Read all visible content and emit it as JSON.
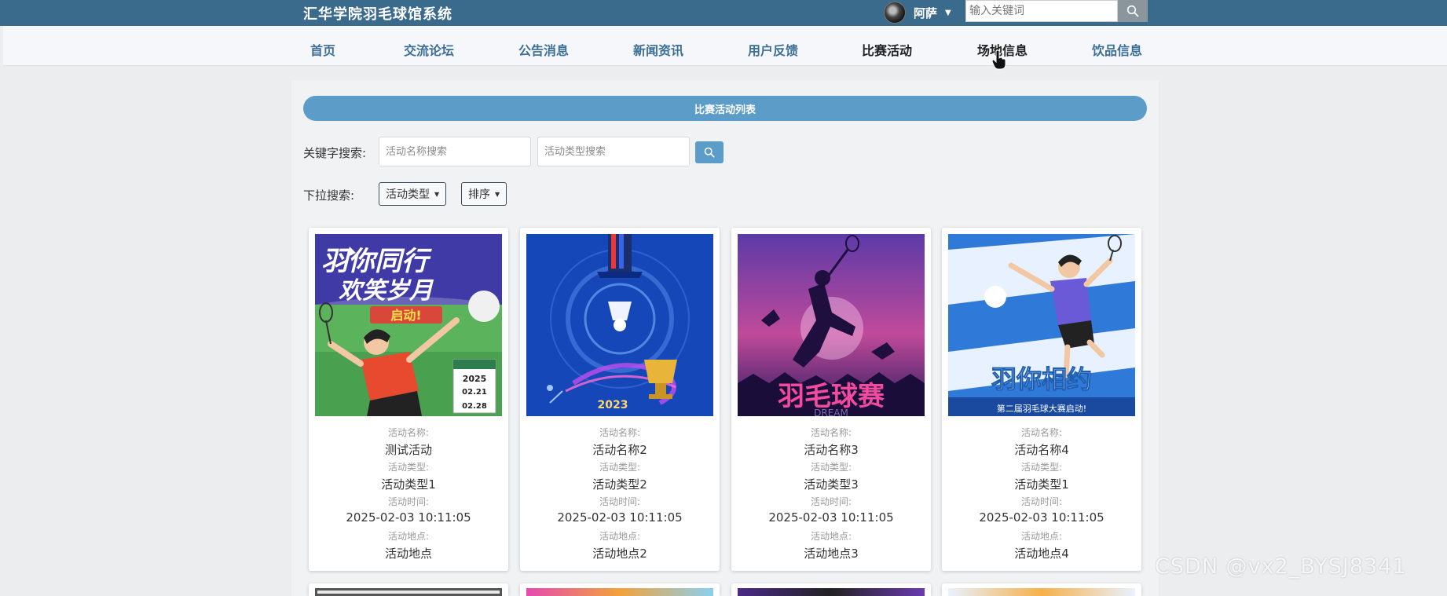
{
  "header": {
    "brand": "汇华学院羽毛球馆系统",
    "username": "阿萨",
    "search_placeholder": "输入关键词"
  },
  "nav": [
    {
      "label": "首页",
      "active": false
    },
    {
      "label": "交流论坛",
      "active": false
    },
    {
      "label": "公告消息",
      "active": false
    },
    {
      "label": "新闻资讯",
      "active": false
    },
    {
      "label": "用户反馈",
      "active": false
    },
    {
      "label": "比赛活动",
      "active": true
    },
    {
      "label": "场地信息",
      "active": true
    },
    {
      "label": "饮品信息",
      "active": false
    }
  ],
  "list_title": "比赛活动列表",
  "filters": {
    "keyword_label": "关键字搜索:",
    "name_placeholder": "活动名称搜索",
    "type_placeholder": "活动类型搜索",
    "dropdown_label": "下拉搜索:",
    "type_dropdown": "活动类型",
    "sort_dropdown": "排序"
  },
  "field_labels": {
    "name": "活动名称:",
    "type": "活动类型:",
    "time": "活动时间:",
    "place": "活动地点:"
  },
  "cards": [
    {
      "name": "测试活动",
      "type": "活动类型1",
      "time": "2025-02-03 10:11:05",
      "place": "活动地点",
      "poster": {
        "line1": "羽你同行",
        "line2": "欢笑岁月",
        "badge": "启动!",
        "date_year": "2025",
        "date_from": "02.21",
        "date_to": "02.28"
      }
    },
    {
      "name": "活动名称2",
      "type": "活动类型2",
      "time": "2025-02-03 10:11:05",
      "place": "活动地点2",
      "poster": {
        "text": "2023"
      }
    },
    {
      "name": "活动名称3",
      "type": "活动类型3",
      "time": "2025-02-03 10:11:05",
      "place": "活动地点3",
      "poster": {
        "title": "羽毛球赛",
        "sub": "DREAM"
      }
    },
    {
      "name": "活动名称4",
      "type": "活动类型1",
      "time": "2025-02-03 10:11:05",
      "place": "活动地点4",
      "poster": {
        "title": "羽你相约",
        "sub": "第二届羽毛球大赛启动!"
      }
    }
  ],
  "watermark": "CSDN @vx2_BYSJ8341",
  "colors": {
    "topbar": "#3a6a8c",
    "accent": "#5b9dc8",
    "nav_text": "#3d6f95"
  }
}
